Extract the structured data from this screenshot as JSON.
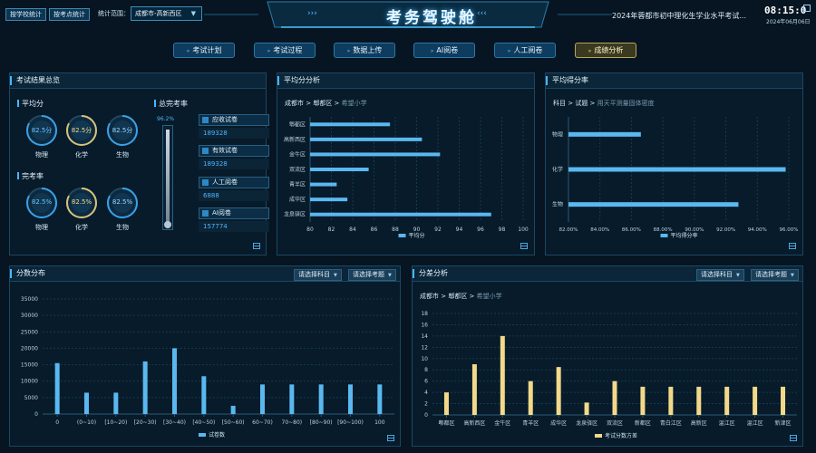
{
  "header": {
    "btn_school": "按学校统计",
    "btn_site": "按考点统计",
    "range_label": "统计范围：",
    "range_value": "成都市-高新西区",
    "title": "考务驾驶舱",
    "exam_name": "2024年蓉都市初中理化生学业水平考试...",
    "time": "08:15:0",
    "date": "2024年06月06日"
  },
  "nav": [
    {
      "label": "考试计划",
      "active": false
    },
    {
      "label": "考试过程",
      "active": false
    },
    {
      "label": "数据上传",
      "active": false
    },
    {
      "label": "AI阅卷",
      "active": false
    },
    {
      "label": "人工阅卷",
      "active": false
    },
    {
      "label": "成绩分析",
      "active": true
    }
  ],
  "summary": {
    "title": "考试结果总览",
    "avg_label": "平均分",
    "complete_label": "完考率",
    "total_label": "总完考率",
    "total_pct": 96.2,
    "total_pct_text": "96.2%",
    "avg_gauges": [
      {
        "value": "82.5分",
        "name": "物理",
        "level": 0.83,
        "color": "#3aa0e8",
        "text_color": "#6fc3ff"
      },
      {
        "value": "82.5分",
        "name": "化学",
        "level": 0.83,
        "color": "#d8c27a",
        "text_color": "#f2dc8a"
      },
      {
        "value": "82.5分",
        "name": "生物",
        "level": 0.83,
        "color": "#3aa0e8",
        "text_color": "#9fd8ff"
      }
    ],
    "complete_gauges": [
      {
        "value": "82.5%",
        "name": "物理",
        "level": 0.83,
        "color": "#3aa0e8",
        "text_color": "#6fc3ff"
      },
      {
        "value": "82.5%",
        "name": "化学",
        "level": 0.83,
        "color": "#d8c27a",
        "text_color": "#f2dc8a"
      },
      {
        "value": "82.5%",
        "name": "生物",
        "level": 0.83,
        "color": "#3aa0e8",
        "text_color": "#9fd8ff"
      }
    ],
    "cards": [
      {
        "label": "应收试卷",
        "value": "189328"
      },
      {
        "label": "有效试卷",
        "value": "189328"
      },
      {
        "label": "人工阅卷",
        "value": "6888"
      },
      {
        "label": "AI阅卷",
        "value": "157774"
      }
    ]
  },
  "avg_panel": {
    "title": "平均分分析",
    "crumb": [
      "成都市",
      "郫都区",
      "希望小学"
    ]
  },
  "rate_panel": {
    "title": "平均得分率",
    "crumb": [
      "科目",
      "试题",
      "用天平测量固体密度"
    ]
  },
  "dist_panel": {
    "title": "分数分布",
    "select_subject": "请选择科目",
    "select_item": "请选择考题"
  },
  "diff_panel": {
    "title": "分差分析",
    "select_subject": "请选择科目",
    "select_item": "请选择考题",
    "crumb": [
      "成都市",
      "郫都区",
      "希望小学"
    ]
  },
  "chart_data": [
    {
      "type": "bar",
      "orientation": "horizontal",
      "categories": [
        "郫都区",
        "高新西区",
        "金牛区",
        "双流区",
        "青羊区",
        "成华区",
        "龙泉驿区"
      ],
      "series": [
        {
          "name": "平均分",
          "values": [
            87.5,
            90.5,
            92.2,
            85.5,
            82.5,
            83.5,
            97
          ]
        }
      ],
      "xlim": [
        80,
        100
      ],
      "ticks": [
        "80",
        "82",
        "84",
        "86",
        "88",
        "90",
        "92",
        "94",
        "96",
        "98",
        "100"
      ],
      "legend": "bottom"
    },
    {
      "type": "bar",
      "orientation": "horizontal",
      "categories": [
        "物理",
        "化学",
        "生物"
      ],
      "series": [
        {
          "name": "平均得分率",
          "values": [
            86.6,
            95.8,
            92.8
          ]
        }
      ],
      "xlim": [
        82,
        96
      ],
      "ticks": [
        "82.00%",
        "84.00%",
        "86.00%",
        "88.00%",
        "90.00%",
        "92.00%",
        "94.00%",
        "96.00%"
      ],
      "legend": "bottom"
    },
    {
      "type": "bar",
      "categories": [
        "0",
        "(0~10)",
        "[10~20)",
        "[20~30)",
        "[30~40)",
        "[40~50)",
        "[50~60)",
        "60~70)",
        "70~80)",
        "[80~90)",
        "[90~100)",
        "100"
      ],
      "series": [
        {
          "name": "试卷数",
          "values": [
            15500,
            6500,
            6500,
            16000,
            20000,
            11500,
            2500,
            9000,
            9000,
            9000,
            9000,
            9000
          ]
        }
      ],
      "ylim": [
        0,
        35000
      ],
      "yticks": [
        "0",
        "5000",
        "10000",
        "15000",
        "20000",
        "25000",
        "30000",
        "35000"
      ],
      "legend": "bottom"
    },
    {
      "type": "bar",
      "categories": [
        "郫都区",
        "高新西区",
        "金牛区",
        "青羊区",
        "成华区",
        "龙泉驿区",
        "双流区",
        "新都区",
        "青白江区",
        "高新区",
        "温江区",
        "温江区",
        "新津区"
      ],
      "series": [
        {
          "name": "考试分数方差",
          "values": [
            4,
            9,
            14,
            6,
            8.5,
            2.2,
            6,
            5,
            5,
            5,
            5,
            5,
            5
          ]
        }
      ],
      "ylim": [
        0,
        18
      ],
      "yticks": [
        "0",
        "2",
        "4",
        "6",
        "8",
        "10",
        "12",
        "14",
        "16",
        "18"
      ],
      "legend": "bottom"
    }
  ]
}
